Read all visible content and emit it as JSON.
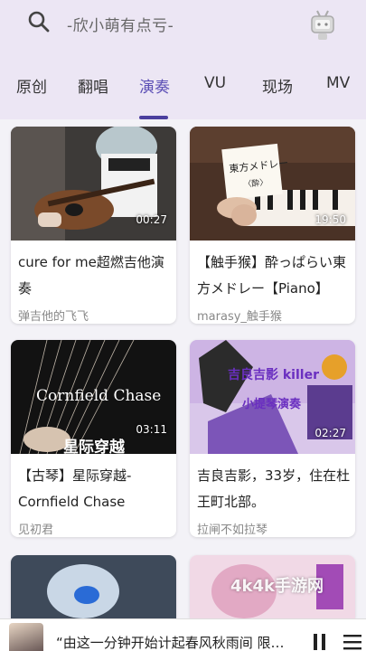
{
  "search": {
    "placeholder": "-欣小萌有点亏-"
  },
  "tabs": [
    {
      "label": "原创"
    },
    {
      "label": "翻唱"
    },
    {
      "label": "演奏"
    },
    {
      "label": "VU"
    },
    {
      "label": "现场"
    },
    {
      "label": "MV"
    }
  ],
  "active_tab": "演奏",
  "videos": [
    {
      "title": "cure for me超燃吉他演奏",
      "author": "弹吉他的飞飞",
      "duration": "00:27"
    },
    {
      "title": "【触手猴】酔っぱらい東方メドレー【Piano】",
      "author": "marasy_触手猴",
      "duration": "19:50"
    },
    {
      "title": "【古琴】星际穿越-Cornfield Chase",
      "author": "见初君",
      "duration": "03:11",
      "thumb_text_1": "Cornfield Chase",
      "thumb_text_2": "星际穿越"
    },
    {
      "title": "吉良吉影，33岁，住在杜王町北部。",
      "author": "拉闸不如拉琴",
      "duration": "02:27",
      "thumb_text_1": "吉良吉影 killer",
      "thumb_text_2": "小提琴演奏"
    }
  ],
  "player": {
    "now_playing": "“由这一分钟开始计起春风秋雨间 限…"
  },
  "watermark": "4k4k手游网",
  "colors": {
    "accent": "#4b3f9e",
    "header_bg": "#ece6f4",
    "page_bg": "#f3f2f7"
  }
}
